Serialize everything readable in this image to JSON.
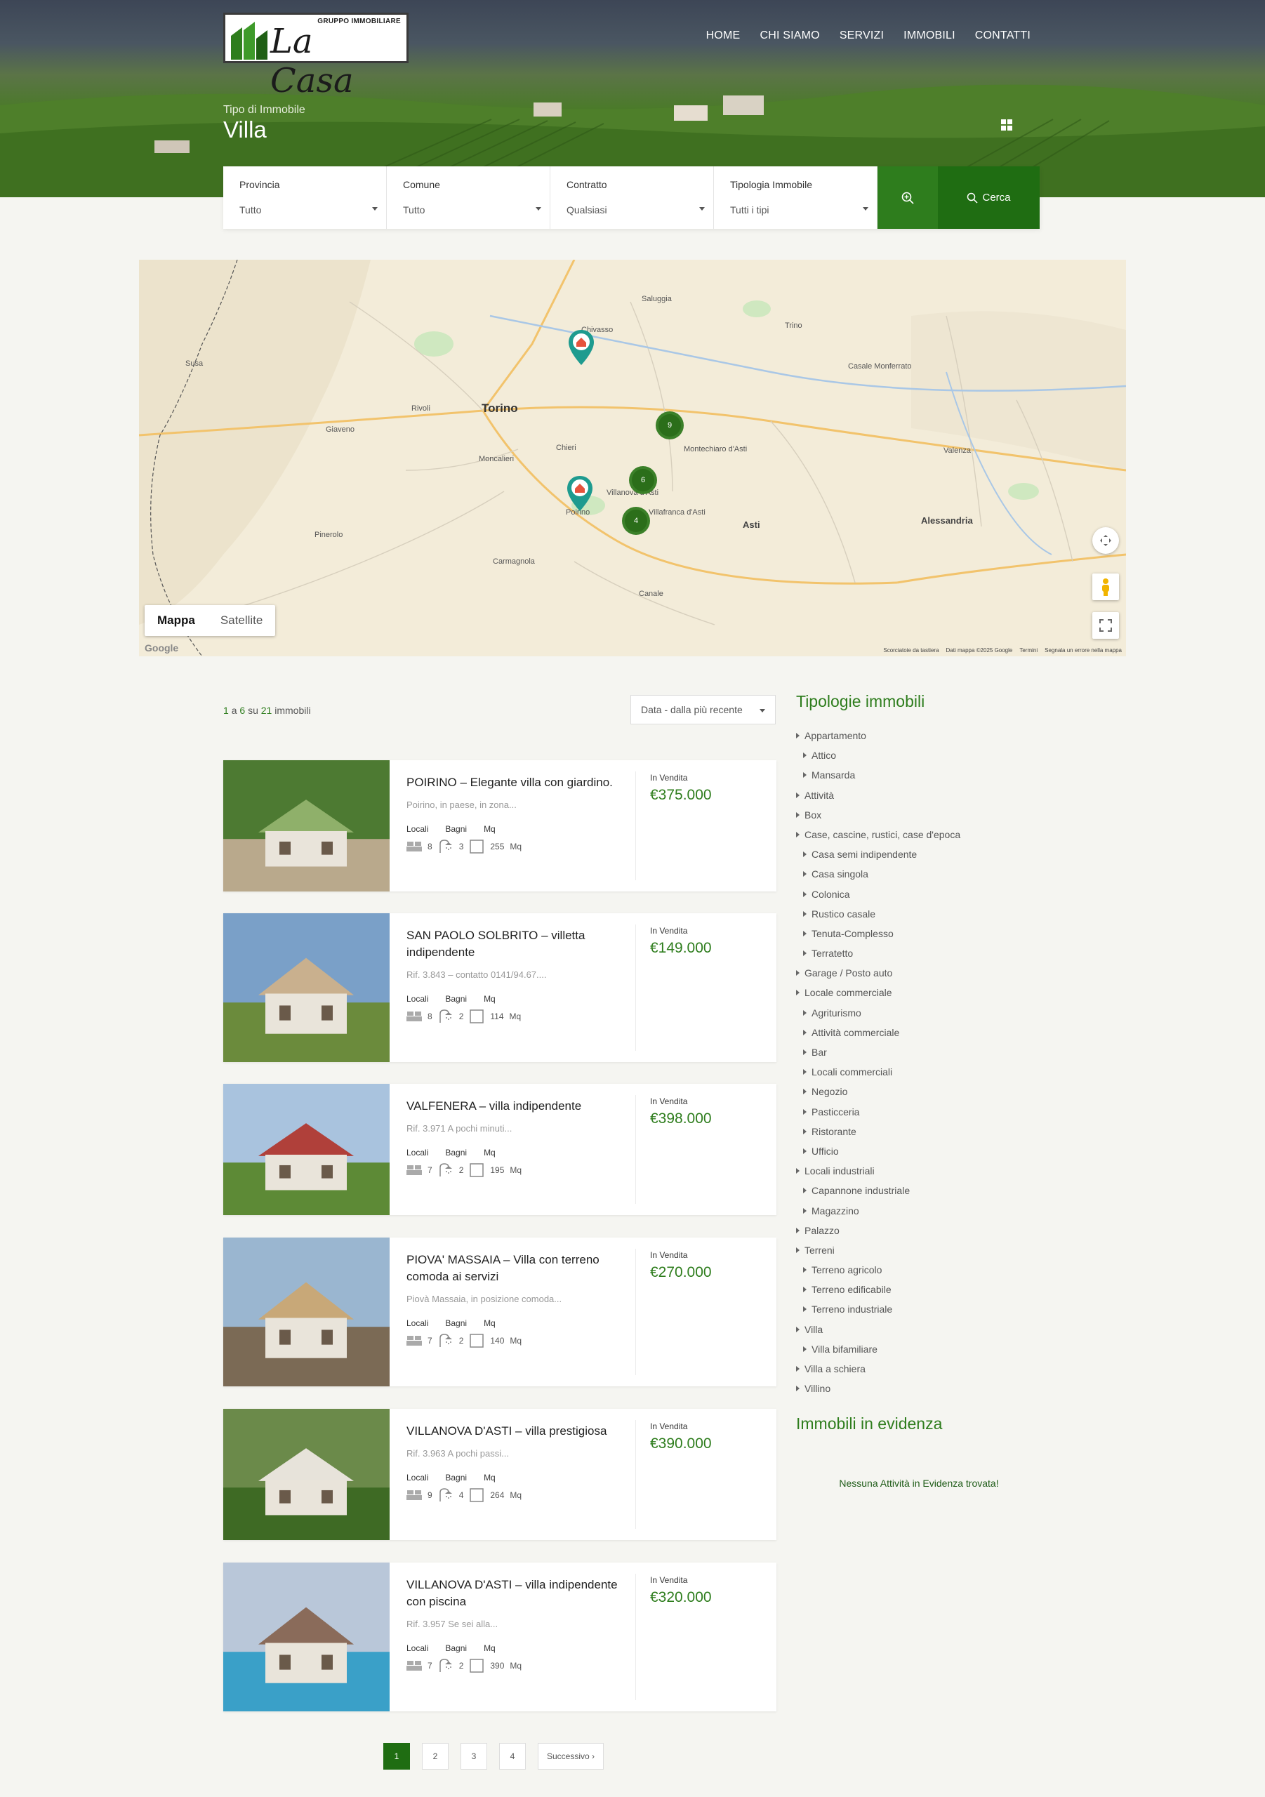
{
  "header": {
    "logo_group": "GRUPPO IMMOBILIARE",
    "logo_name": "La Casa",
    "nav": [
      "HOME",
      "CHI SIAMO",
      "SERVIZI",
      "IMMOBILI",
      "CONTATTI"
    ],
    "subtitle": "Tipo di Immobile",
    "title": "Villa"
  },
  "search": {
    "fields": [
      {
        "label": "Provincia",
        "value": "Tutto"
      },
      {
        "label": "Comune",
        "value": "Tutto"
      },
      {
        "label": "Contratto",
        "value": "Qualsiasi"
      },
      {
        "label": "Tipologia Immobile",
        "value": "Tutti i tipi"
      }
    ],
    "cerca_label": "Cerca"
  },
  "map": {
    "labels": {
      "torino": "Torino",
      "asti": "Asti",
      "alessandria": "Alessandria",
      "chieri": "Chieri",
      "moncalieri": "Moncalieri",
      "rivoli": "Rivoli",
      "chivasso": "Chivasso",
      "poirino": "Poirino",
      "villanova": "Villanova d'Asti",
      "montechiaro": "Montechiaro d'Asti",
      "carmagnola": "Carmagnola",
      "pinerolo": "Pinerolo",
      "trino": "Trino",
      "casale": "Casale Monferrato",
      "valenza": "Valenza",
      "canale": "Canale",
      "villafranca": "Villafranca d'Asti",
      "susa": "Susa",
      "giaveno": "Giaveno",
      "saluggia": "Saluggia"
    },
    "clusters": [
      "9",
      "6",
      "4"
    ],
    "toggle": [
      "Mappa",
      "Satellite"
    ],
    "google": "Google",
    "footer": [
      "Scorciatoie da tastiera",
      "Dati mappa ©2025 Google",
      "Termini",
      "Segnala un errore nella mappa"
    ]
  },
  "results": {
    "from": "1",
    "a": "a",
    "to": "6",
    "su": "su",
    "total": "21",
    "suffix": "immobili",
    "sort": "Data - dalla più recente"
  },
  "feature_labels": [
    "Locali",
    "Bagni",
    "Mq"
  ],
  "listings": [
    {
      "title": "POIRINO – Elegante villa con giardino.",
      "desc": "Poirino, in paese, in zona...",
      "locali": "8",
      "bagni": "3",
      "mq": "255",
      "unit": "Mq",
      "status": "In Vendita",
      "price": "€375.000"
    },
    {
      "title": "SAN PAOLO SOLBRITO – villetta indipendente",
      "desc": "Rif. 3.843 – contatto 0141/94.67....",
      "locali": "8",
      "bagni": "2",
      "mq": "114",
      "unit": "Mq",
      "status": "In Vendita",
      "price": "€149.000"
    },
    {
      "title": "VALFENERA – villa indipendente",
      "desc": "Rif. 3.971 A pochi minuti...",
      "locali": "7",
      "bagni": "2",
      "mq": "195",
      "unit": "Mq",
      "status": "In Vendita",
      "price": "€398.000"
    },
    {
      "title": "PIOVA' MASSAIA – Villa con terreno comoda ai servizi",
      "desc": "Piovà Massaia, in posizione comoda...",
      "locali": "7",
      "bagni": "2",
      "mq": "140",
      "unit": "Mq",
      "status": "In Vendita",
      "price": "€270.000"
    },
    {
      "title": "VILLANOVA D'ASTI – villa prestigiosa",
      "desc": "Rif. 3.963 A pochi passi...",
      "locali": "9",
      "bagni": "4",
      "mq": "264",
      "unit": "Mq",
      "status": "In Vendita",
      "price": "€390.000"
    },
    {
      "title": "VILLANOVA D'ASTI – villa indipendente con piscina",
      "desc": "Rif. 3.957 Se sei alla...",
      "locali": "7",
      "bagni": "2",
      "mq": "390",
      "unit": "Mq",
      "status": "In Vendita",
      "price": "€320.000"
    }
  ],
  "sidebar": {
    "types_title": "Tipologie immobili",
    "categories": [
      {
        "label": "Appartamento",
        "sub": false
      },
      {
        "label": "Attico",
        "sub": true
      },
      {
        "label": "Mansarda",
        "sub": true
      },
      {
        "label": "Attività",
        "sub": false
      },
      {
        "label": "Box",
        "sub": false
      },
      {
        "label": "Case, cascine, rustici, case d'epoca",
        "sub": false
      },
      {
        "label": "Casa semi indipendente",
        "sub": true
      },
      {
        "label": "Casa singola",
        "sub": true
      },
      {
        "label": "Colonica",
        "sub": true
      },
      {
        "label": "Rustico casale",
        "sub": true
      },
      {
        "label": "Tenuta-Complesso",
        "sub": true
      },
      {
        "label": "Terratetto",
        "sub": true
      },
      {
        "label": "Garage / Posto auto",
        "sub": false
      },
      {
        "label": "Locale commerciale",
        "sub": false
      },
      {
        "label": "Agriturismo",
        "sub": true
      },
      {
        "label": "Attività commerciale",
        "sub": true
      },
      {
        "label": "Bar",
        "sub": true
      },
      {
        "label": "Locali commerciali",
        "sub": true
      },
      {
        "label": "Negozio",
        "sub": true
      },
      {
        "label": "Pasticceria",
        "sub": true
      },
      {
        "label": "Ristorante",
        "sub": true
      },
      {
        "label": "Ufficio",
        "sub": true
      },
      {
        "label": "Locali industriali",
        "sub": false
      },
      {
        "label": "Capannone industriale",
        "sub": true
      },
      {
        "label": "Magazzino",
        "sub": true
      },
      {
        "label": "Palazzo",
        "sub": false
      },
      {
        "label": "Terreni",
        "sub": false
      },
      {
        "label": "Terreno agricolo",
        "sub": true
      },
      {
        "label": "Terreno edificabile",
        "sub": true
      },
      {
        "label": "Terreno industriale",
        "sub": true
      },
      {
        "label": "Villa",
        "sub": false
      },
      {
        "label": "Villa bifamiliare",
        "sub": true
      },
      {
        "label": "Villa a schiera",
        "sub": false
      },
      {
        "label": "Villino",
        "sub": false
      }
    ],
    "featured_title": "Immobili in evidenza",
    "featured_empty": "Nessuna Attività in Evidenza trovata!"
  },
  "pagination": {
    "pages": [
      "1",
      "2",
      "3",
      "4"
    ],
    "next": "Successivo ›"
  },
  "colors": {
    "accent": "#2e7d1d",
    "dark_accent": "#1f6d12"
  }
}
